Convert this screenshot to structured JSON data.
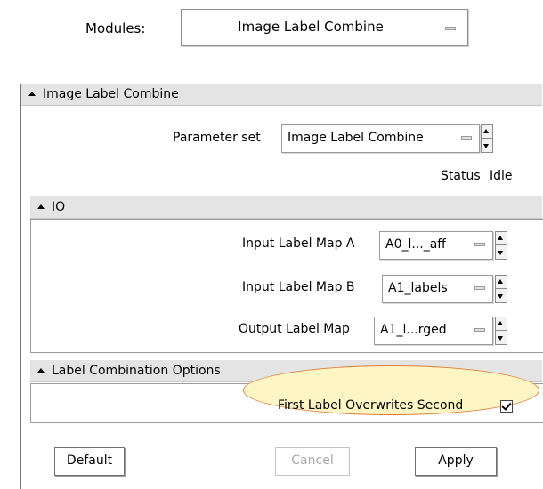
{
  "modules": {
    "label": "Modules:",
    "selected": "Image Label Combine"
  },
  "panel": {
    "title": "Image Label Combine",
    "parameter_set": {
      "label": "Parameter set",
      "value": "Image Label Combine"
    },
    "status": {
      "label": "Status",
      "value": "Idle"
    },
    "io": {
      "title": "IO",
      "rows": [
        {
          "label": "Input Label Map A",
          "value": "A0_l..._aff"
        },
        {
          "label": "Input Label Map B",
          "value": "A1_labels"
        },
        {
          "label": "Output Label Map",
          "value": "A1_l...rged"
        }
      ]
    },
    "options": {
      "title": "Label Combination Options",
      "first_label_overwrites": {
        "label": "First Label Overwrites Second",
        "checked": true
      }
    },
    "buttons": {
      "default": "Default",
      "cancel": "Cancel",
      "apply": "Apply"
    }
  },
  "colors": {
    "highlight_fill": "#fdf6c4",
    "highlight_border": "#e07d3a",
    "header_bg": "#e4e4e4"
  }
}
